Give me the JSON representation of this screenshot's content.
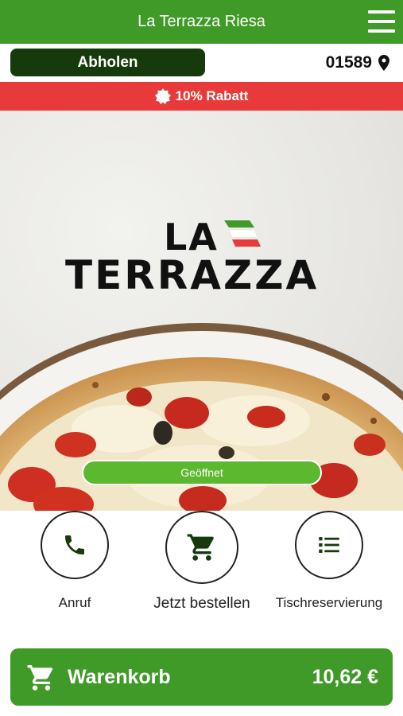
{
  "header": {
    "title": "La Terrazza Riesa",
    "menu_icon": "hamburger-menu-icon"
  },
  "order_bar": {
    "mode_label": "Abholen",
    "postal_code": "01589",
    "location_icon": "map-pin-icon"
  },
  "promo": {
    "icon": "badge-icon",
    "text": "10% Rabatt"
  },
  "hero": {
    "logo_line1": "LA",
    "logo_line2": "TERRAZZA",
    "status_label": "Geöffnet"
  },
  "actions": [
    {
      "label": "Anruf",
      "icon": "phone-icon"
    },
    {
      "label": "Jetzt bestellen",
      "icon": "cart-icon"
    },
    {
      "label": "Tischreservierung",
      "icon": "list-icon"
    }
  ],
  "cart": {
    "label": "Warenkorb",
    "total": "10,62 €",
    "icon": "cart-icon"
  },
  "colors": {
    "primary_green": "#3f9a28",
    "dark_green": "#173a0d",
    "promo_red": "#e83a3a",
    "status_green": "#5cb82e"
  }
}
